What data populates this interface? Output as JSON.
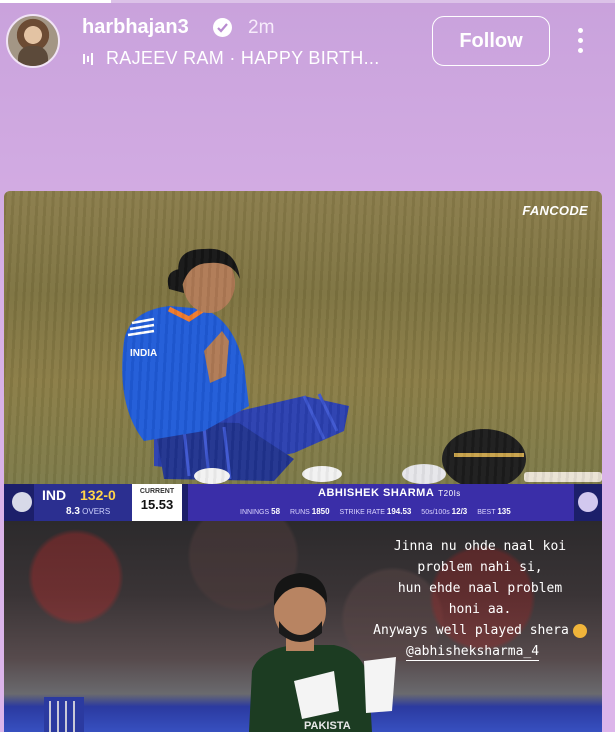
{
  "story": {
    "progress": 0.18,
    "username": "harbhajan3",
    "time_ago": "2m",
    "music": "RAJEEV RAM · HAPPY BIRTH...",
    "follow_label": "Follow"
  },
  "post": {
    "watermark": "FANCODE",
    "scoreboard": {
      "team": "IND",
      "score": "132-0",
      "overs": "8.3",
      "overs_label": "OVERS",
      "current_label": "CURRENT",
      "current_value": "15.53",
      "player_name": "ABHISHEK SHARMA",
      "format": "T20Is",
      "stats": [
        {
          "label": "INNINGS",
          "value": "58"
        },
        {
          "label": "RUNS",
          "value": "1850"
        },
        {
          "label": "STRIKE RATE",
          "value": "194.53"
        },
        {
          "label": "50s/100s",
          "value": "12/3"
        },
        {
          "label": "BEST",
          "value": "135"
        }
      ]
    },
    "caption_lines": [
      "Jinna nu ohde naal koi",
      "problem nahi si,",
      "hun ehde naal problem",
      "honi aa.",
      "Anyways well played shera"
    ],
    "mention": "@abhisheksharma_4"
  },
  "colors": {
    "background": "#d7b0e6",
    "scorebar": "#1c1f6a",
    "score_accent": "#ffd34a"
  }
}
